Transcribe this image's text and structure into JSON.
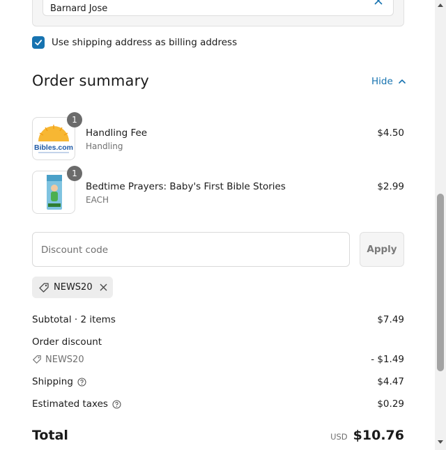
{
  "shipping": {
    "name_value": "Barnard Jose",
    "billing_checkbox_label": "Use shipping address as billing address",
    "billing_checked": true
  },
  "summary": {
    "title": "Order summary",
    "toggle_label": "Hide"
  },
  "items": [
    {
      "name": "Handling Fee",
      "variant": "Handling",
      "price": "$4.50",
      "quantity": "1",
      "image_icon": "bibles-com-logo"
    },
    {
      "name": "Bedtime Prayers: Baby's First Bible Stories",
      "variant": "EACH",
      "price": "$2.99",
      "quantity": "1",
      "image_icon": "book-cover"
    }
  ],
  "discount": {
    "placeholder": "Discount code",
    "apply_label": "Apply",
    "applied_code": "NEWS20"
  },
  "totals": {
    "subtotal_label": "Subtotal · 2 items",
    "subtotal_value": "$7.49",
    "order_discount_label": "Order discount",
    "order_discount_code": "NEWS20",
    "order_discount_value": "- $1.49",
    "shipping_label": "Shipping",
    "shipping_value": "$4.47",
    "taxes_label": "Estimated taxes",
    "taxes_value": "$0.29",
    "total_label": "Total",
    "total_currency": "USD",
    "total_value": "$10.76"
  },
  "logo_text": "Bibles.com",
  "colors": {
    "accent": "#1773b0",
    "muted": "#707070",
    "badge": "#6b6b6b"
  }
}
